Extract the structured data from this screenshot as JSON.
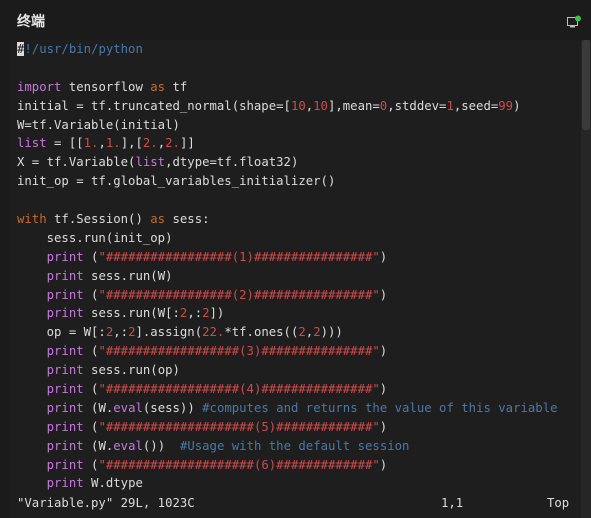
{
  "window": {
    "title": "终端",
    "icon": "terminal-icon"
  },
  "colors": {
    "background": "#1e1e1e",
    "keyword": "#c678dd",
    "string": "#d14a4a",
    "comment": "#4a78a8",
    "text": "#dcdcdc"
  },
  "code": {
    "lines": [
      [
        {
          "t": "#",
          "c": "cursor"
        },
        {
          "t": "!/usr/bin/python",
          "c": "c-cm"
        }
      ],
      [],
      [
        {
          "t": "import",
          "c": "c-kw"
        },
        {
          "t": " tensorflow ",
          "c": "c-plain"
        },
        {
          "t": "as",
          "c": "c-kw2"
        },
        {
          "t": " tf",
          "c": "c-plain"
        }
      ],
      [
        {
          "t": "initial = tf.truncated_normal(shape=[",
          "c": "c-plain"
        },
        {
          "t": "10",
          "c": "c-num"
        },
        {
          "t": ",",
          "c": "c-plain"
        },
        {
          "t": "10",
          "c": "c-num"
        },
        {
          "t": "],mean=",
          "c": "c-plain"
        },
        {
          "t": "0",
          "c": "c-num"
        },
        {
          "t": ",stddev=",
          "c": "c-plain"
        },
        {
          "t": "1",
          "c": "c-num"
        },
        {
          "t": ",seed=",
          "c": "c-plain"
        },
        {
          "t": "99",
          "c": "c-num"
        },
        {
          "t": ")",
          "c": "c-plain"
        }
      ],
      [
        {
          "t": "W=tf.Variable(initial)",
          "c": "c-plain"
        }
      ],
      [
        {
          "t": "list",
          "c": "c-kw"
        },
        {
          "t": " = [[",
          "c": "c-plain"
        },
        {
          "t": "1.",
          "c": "c-num"
        },
        {
          "t": ",",
          "c": "c-plain"
        },
        {
          "t": "1.",
          "c": "c-num"
        },
        {
          "t": "],[",
          "c": "c-plain"
        },
        {
          "t": "2.",
          "c": "c-num"
        },
        {
          "t": ",",
          "c": "c-plain"
        },
        {
          "t": "2.",
          "c": "c-num"
        },
        {
          "t": "]]",
          "c": "c-plain"
        }
      ],
      [
        {
          "t": "X = tf.Variable(",
          "c": "c-plain"
        },
        {
          "t": "list",
          "c": "c-kw"
        },
        {
          "t": ",dtype=tf.float32)",
          "c": "c-plain"
        }
      ],
      [
        {
          "t": "init_op = tf.global_variables_initializer()",
          "c": "c-plain"
        }
      ],
      [],
      [
        {
          "t": "with",
          "c": "c-kw2"
        },
        {
          "t": " tf.Session() ",
          "c": "c-plain"
        },
        {
          "t": "as",
          "c": "c-kw2"
        },
        {
          "t": " sess:",
          "c": "c-plain"
        }
      ],
      [
        {
          "t": "    sess.run(init_op)",
          "c": "c-plain"
        }
      ],
      [
        {
          "t": "    ",
          "c": "c-plain"
        },
        {
          "t": "print",
          "c": "c-kw"
        },
        {
          "t": " (",
          "c": "c-plain"
        },
        {
          "t": "\"#################(1)################\"",
          "c": "c-str"
        },
        {
          "t": ")",
          "c": "c-plain"
        }
      ],
      [
        {
          "t": "    ",
          "c": "c-plain"
        },
        {
          "t": "print",
          "c": "c-kw"
        },
        {
          "t": " sess.run(W)",
          "c": "c-plain"
        }
      ],
      [
        {
          "t": "    ",
          "c": "c-plain"
        },
        {
          "t": "print",
          "c": "c-kw"
        },
        {
          "t": " (",
          "c": "c-plain"
        },
        {
          "t": "\"#################(2)################\"",
          "c": "c-str"
        },
        {
          "t": ")",
          "c": "c-plain"
        }
      ],
      [
        {
          "t": "    ",
          "c": "c-plain"
        },
        {
          "t": "print",
          "c": "c-kw"
        },
        {
          "t": " sess.run(W[:",
          "c": "c-plain"
        },
        {
          "t": "2",
          "c": "c-num"
        },
        {
          "t": ",:",
          "c": "c-plain"
        },
        {
          "t": "2",
          "c": "c-num"
        },
        {
          "t": "])",
          "c": "c-plain"
        }
      ],
      [
        {
          "t": "    op = W[:",
          "c": "c-plain"
        },
        {
          "t": "2",
          "c": "c-num"
        },
        {
          "t": ",:",
          "c": "c-plain"
        },
        {
          "t": "2",
          "c": "c-num"
        },
        {
          "t": "].assign(",
          "c": "c-plain"
        },
        {
          "t": "22.",
          "c": "c-num"
        },
        {
          "t": "*tf.ones((",
          "c": "c-plain"
        },
        {
          "t": "2",
          "c": "c-num"
        },
        {
          "t": ",",
          "c": "c-plain"
        },
        {
          "t": "2",
          "c": "c-num"
        },
        {
          "t": ")))",
          "c": "c-plain"
        }
      ],
      [
        {
          "t": "    ",
          "c": "c-plain"
        },
        {
          "t": "print",
          "c": "c-kw"
        },
        {
          "t": " (",
          "c": "c-plain"
        },
        {
          "t": "\"##################(3)###############\"",
          "c": "c-str"
        },
        {
          "t": ")",
          "c": "c-plain"
        }
      ],
      [
        {
          "t": "    ",
          "c": "c-plain"
        },
        {
          "t": "print",
          "c": "c-kw"
        },
        {
          "t": " sess.run(op)",
          "c": "c-plain"
        }
      ],
      [
        {
          "t": "    ",
          "c": "c-plain"
        },
        {
          "t": "print",
          "c": "c-kw"
        },
        {
          "t": " (",
          "c": "c-plain"
        },
        {
          "t": "\"##################(4)###############\"",
          "c": "c-str"
        },
        {
          "t": ")",
          "c": "c-plain"
        }
      ],
      [
        {
          "t": "    ",
          "c": "c-plain"
        },
        {
          "t": "print",
          "c": "c-kw"
        },
        {
          "t": " (W.",
          "c": "c-plain"
        },
        {
          "t": "eval",
          "c": "c-kw"
        },
        {
          "t": "(sess)) ",
          "c": "c-plain"
        },
        {
          "t": "#computes and returns the value of this variable",
          "c": "c-cm"
        }
      ],
      [
        {
          "t": "    ",
          "c": "c-plain"
        },
        {
          "t": "print",
          "c": "c-kw"
        },
        {
          "t": " (",
          "c": "c-plain"
        },
        {
          "t": "\"####################(5)#############\"",
          "c": "c-str"
        },
        {
          "t": ")",
          "c": "c-plain"
        }
      ],
      [
        {
          "t": "    ",
          "c": "c-plain"
        },
        {
          "t": "print",
          "c": "c-kw"
        },
        {
          "t": " (W.",
          "c": "c-plain"
        },
        {
          "t": "eval",
          "c": "c-kw"
        },
        {
          "t": "())  ",
          "c": "c-plain"
        },
        {
          "t": "#Usage with the default session",
          "c": "c-cm"
        }
      ],
      [
        {
          "t": "    ",
          "c": "c-plain"
        },
        {
          "t": "print",
          "c": "c-kw"
        },
        {
          "t": " (",
          "c": "c-plain"
        },
        {
          "t": "\"####################(6)#############\"",
          "c": "c-str"
        },
        {
          "t": ")",
          "c": "c-plain"
        }
      ],
      [
        {
          "t": "    ",
          "c": "c-plain"
        },
        {
          "t": "print",
          "c": "c-kw"
        },
        {
          "t": " W.dtype",
          "c": "c-plain"
        }
      ]
    ]
  },
  "status": {
    "file": "\"Variable.py\" 29L, 1023C",
    "position": "1,1",
    "scroll": "Top"
  }
}
